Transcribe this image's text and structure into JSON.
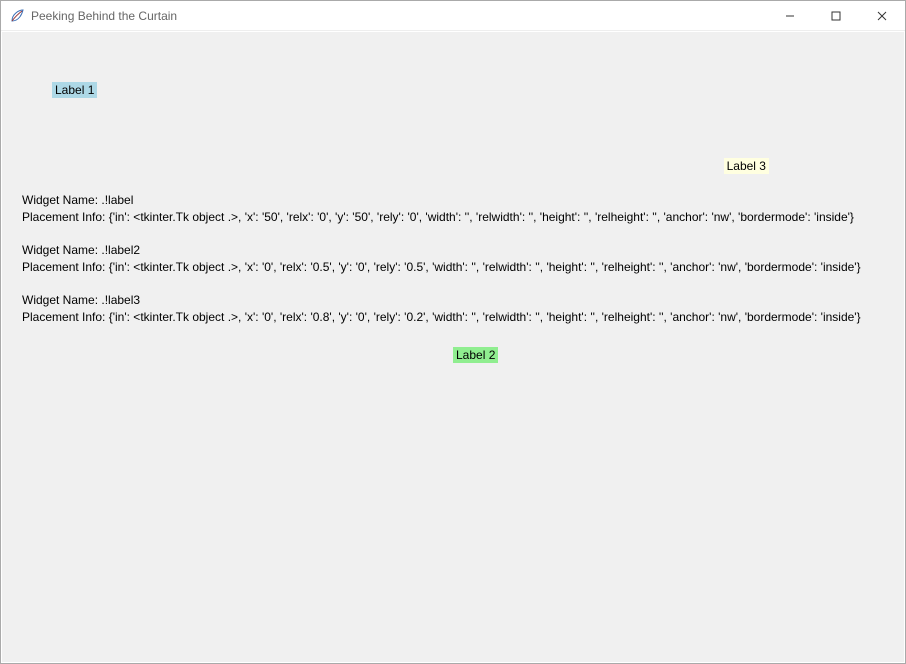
{
  "window": {
    "title": "Peeking Behind the Curtain"
  },
  "labels": {
    "label1": "Label 1",
    "label2": "Label 2",
    "label3": "Label 3"
  },
  "info1": {
    "name_line": "Widget Name: .!label",
    "place_line": "Placement Info: {'in': <tkinter.Tk object .>, 'x': '50', 'relx': '0', 'y': '50', 'rely': '0', 'width': '', 'relwidth': '', 'height': '', 'relheight': '', 'anchor': 'nw', 'bordermode': 'inside'}"
  },
  "info2": {
    "name_line": "Widget Name: .!label2",
    "place_line": "Placement Info: {'in': <tkinter.Tk object .>, 'x': '0', 'relx': '0.5', 'y': '0', 'rely': '0.5', 'width': '', 'relwidth': '', 'height': '', 'relheight': '', 'anchor': 'nw', 'bordermode': 'inside'}"
  },
  "info3": {
    "name_line": "Widget Name: .!label3",
    "place_line": "Placement Info: {'in': <tkinter.Tk object .>, 'x': '0', 'relx': '0.8', 'y': '0', 'rely': '0.2', 'width': '', 'relwidth': '', 'height': '', 'relheight': '', 'anchor': 'nw', 'bordermode': 'inside'}"
  }
}
